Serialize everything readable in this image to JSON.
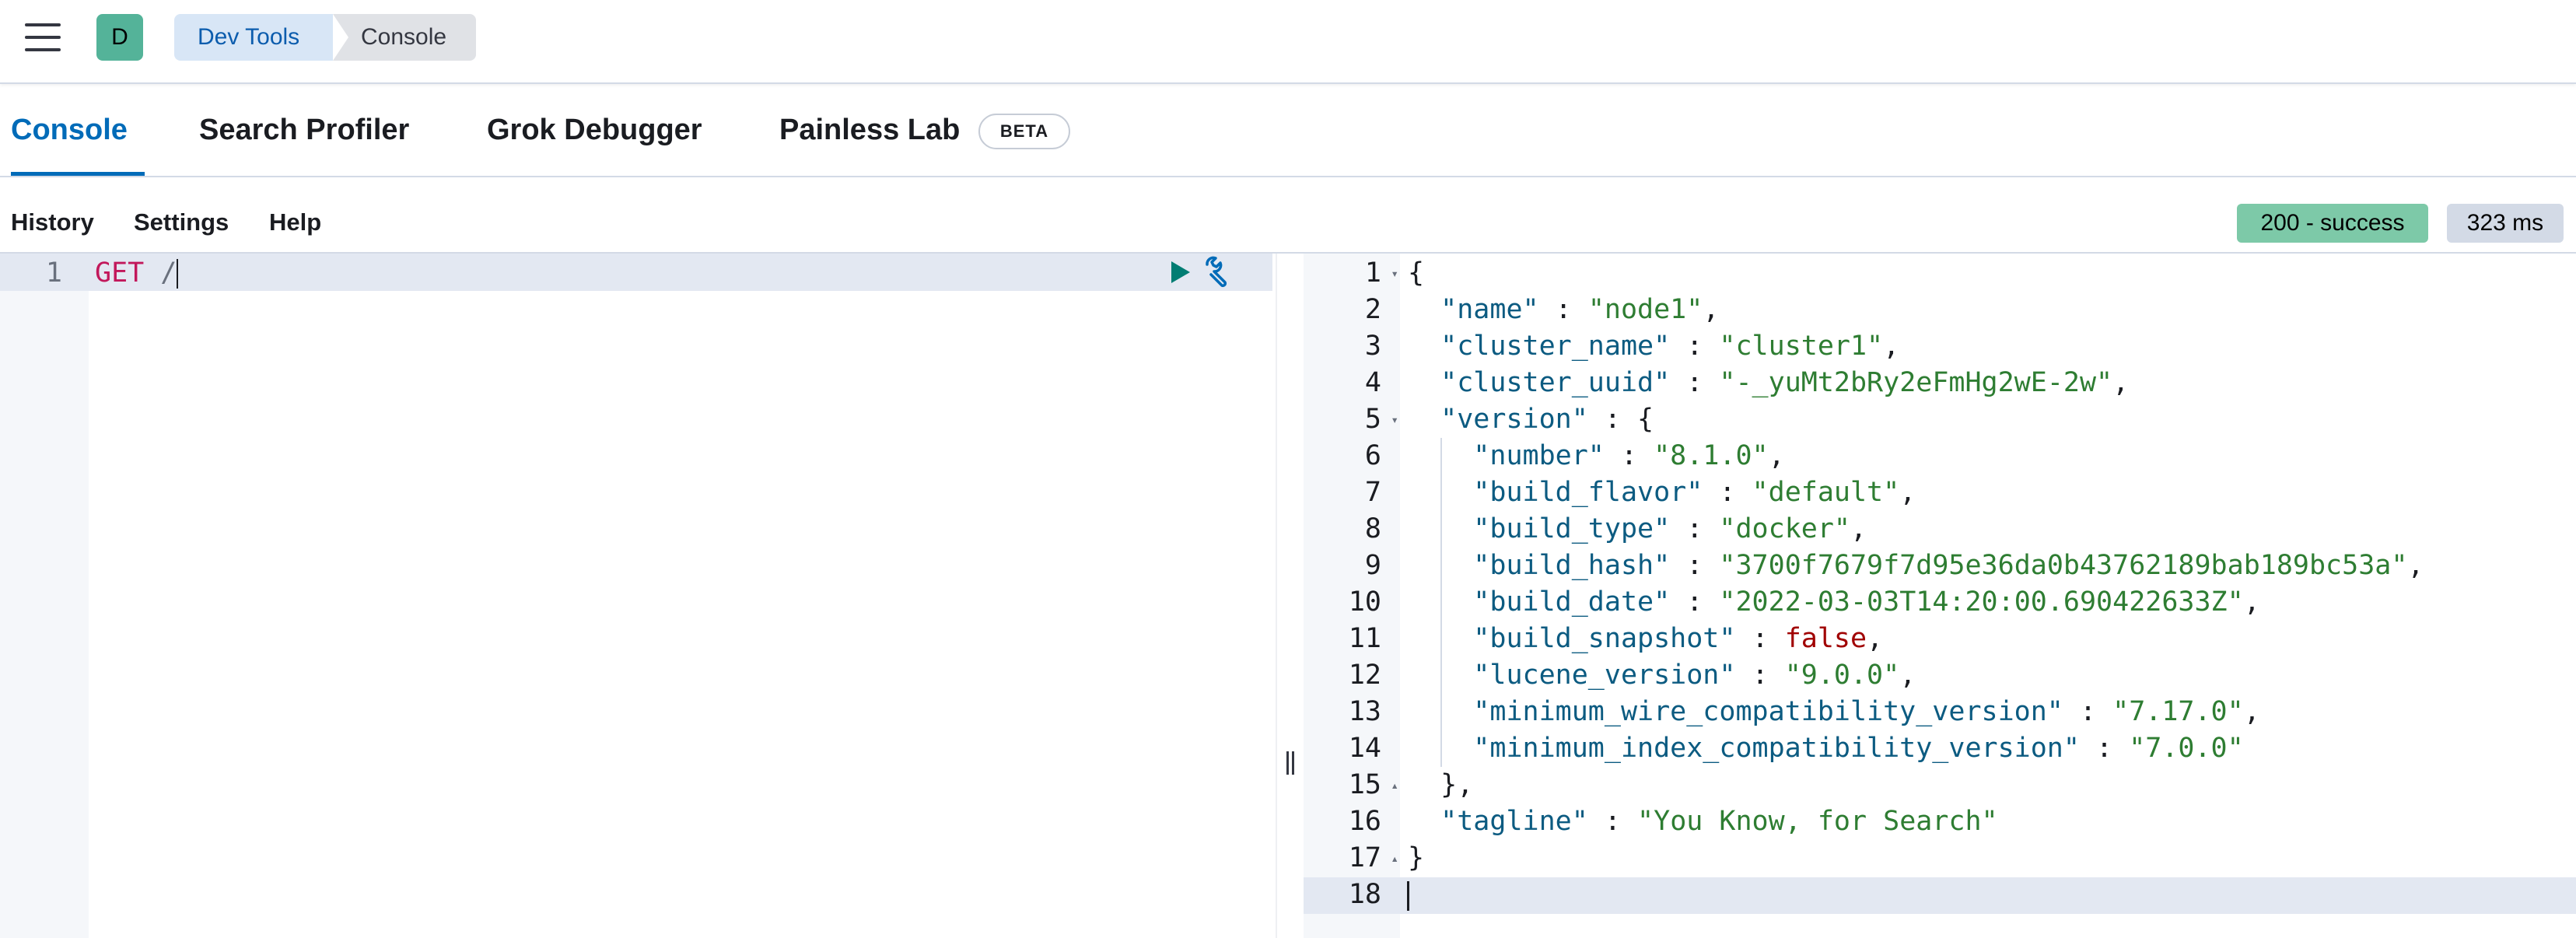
{
  "header": {
    "avatar_letter": "D",
    "breadcrumbs": [
      "Dev Tools",
      "Console"
    ]
  },
  "tabs": [
    {
      "label": "Console",
      "active": true
    },
    {
      "label": "Search Profiler",
      "active": false
    },
    {
      "label": "Grok Debugger",
      "active": false
    },
    {
      "label": "Painless Lab",
      "active": false,
      "badge": "BETA"
    }
  ],
  "toolbar": {
    "history": "History",
    "settings": "Settings",
    "help": "Help",
    "status": "200 - success",
    "duration": "323 ms"
  },
  "request": {
    "line_number": "1",
    "method": "GET",
    "path": "/"
  },
  "response": {
    "line_numbers": [
      "1",
      "2",
      "3",
      "4",
      "5",
      "6",
      "7",
      "8",
      "9",
      "10",
      "11",
      "12",
      "13",
      "14",
      "15",
      "16",
      "17",
      "18"
    ],
    "lines": [
      "{",
      "  \"name\" : \"node1\",",
      "  \"cluster_name\" : \"cluster1\",",
      "  \"cluster_uuid\" : \"-_yuMt2bRy2eFmHg2wE-2w\",",
      "  \"version\" : {",
      "    \"number\" : \"8.1.0\",",
      "    \"build_flavor\" : \"default\",",
      "    \"build_type\" : \"docker\",",
      "    \"build_hash\" : \"3700f7679f7d95e36da0b43762189bab189bc53a\",",
      "    \"build_date\" : \"2022-03-03T14:20:00.690422633Z\",",
      "    \"build_snapshot\" : false,",
      "    \"lucene_version\" : \"9.0.0\",",
      "    \"minimum_wire_compatibility_version\" : \"7.17.0\",",
      "    \"minimum_index_compatibility_version\" : \"7.0.0\"",
      "  },",
      "  \"tagline\" : \"You Know, for Search\"",
      "}",
      ""
    ]
  },
  "colors": {
    "accent": "#006bb8",
    "success_badge": "#7dc9a8",
    "avatar": "#54b399"
  },
  "icons": {
    "menu": "hamburger-icon",
    "run": "play-icon",
    "settings": "wrench-icon"
  }
}
